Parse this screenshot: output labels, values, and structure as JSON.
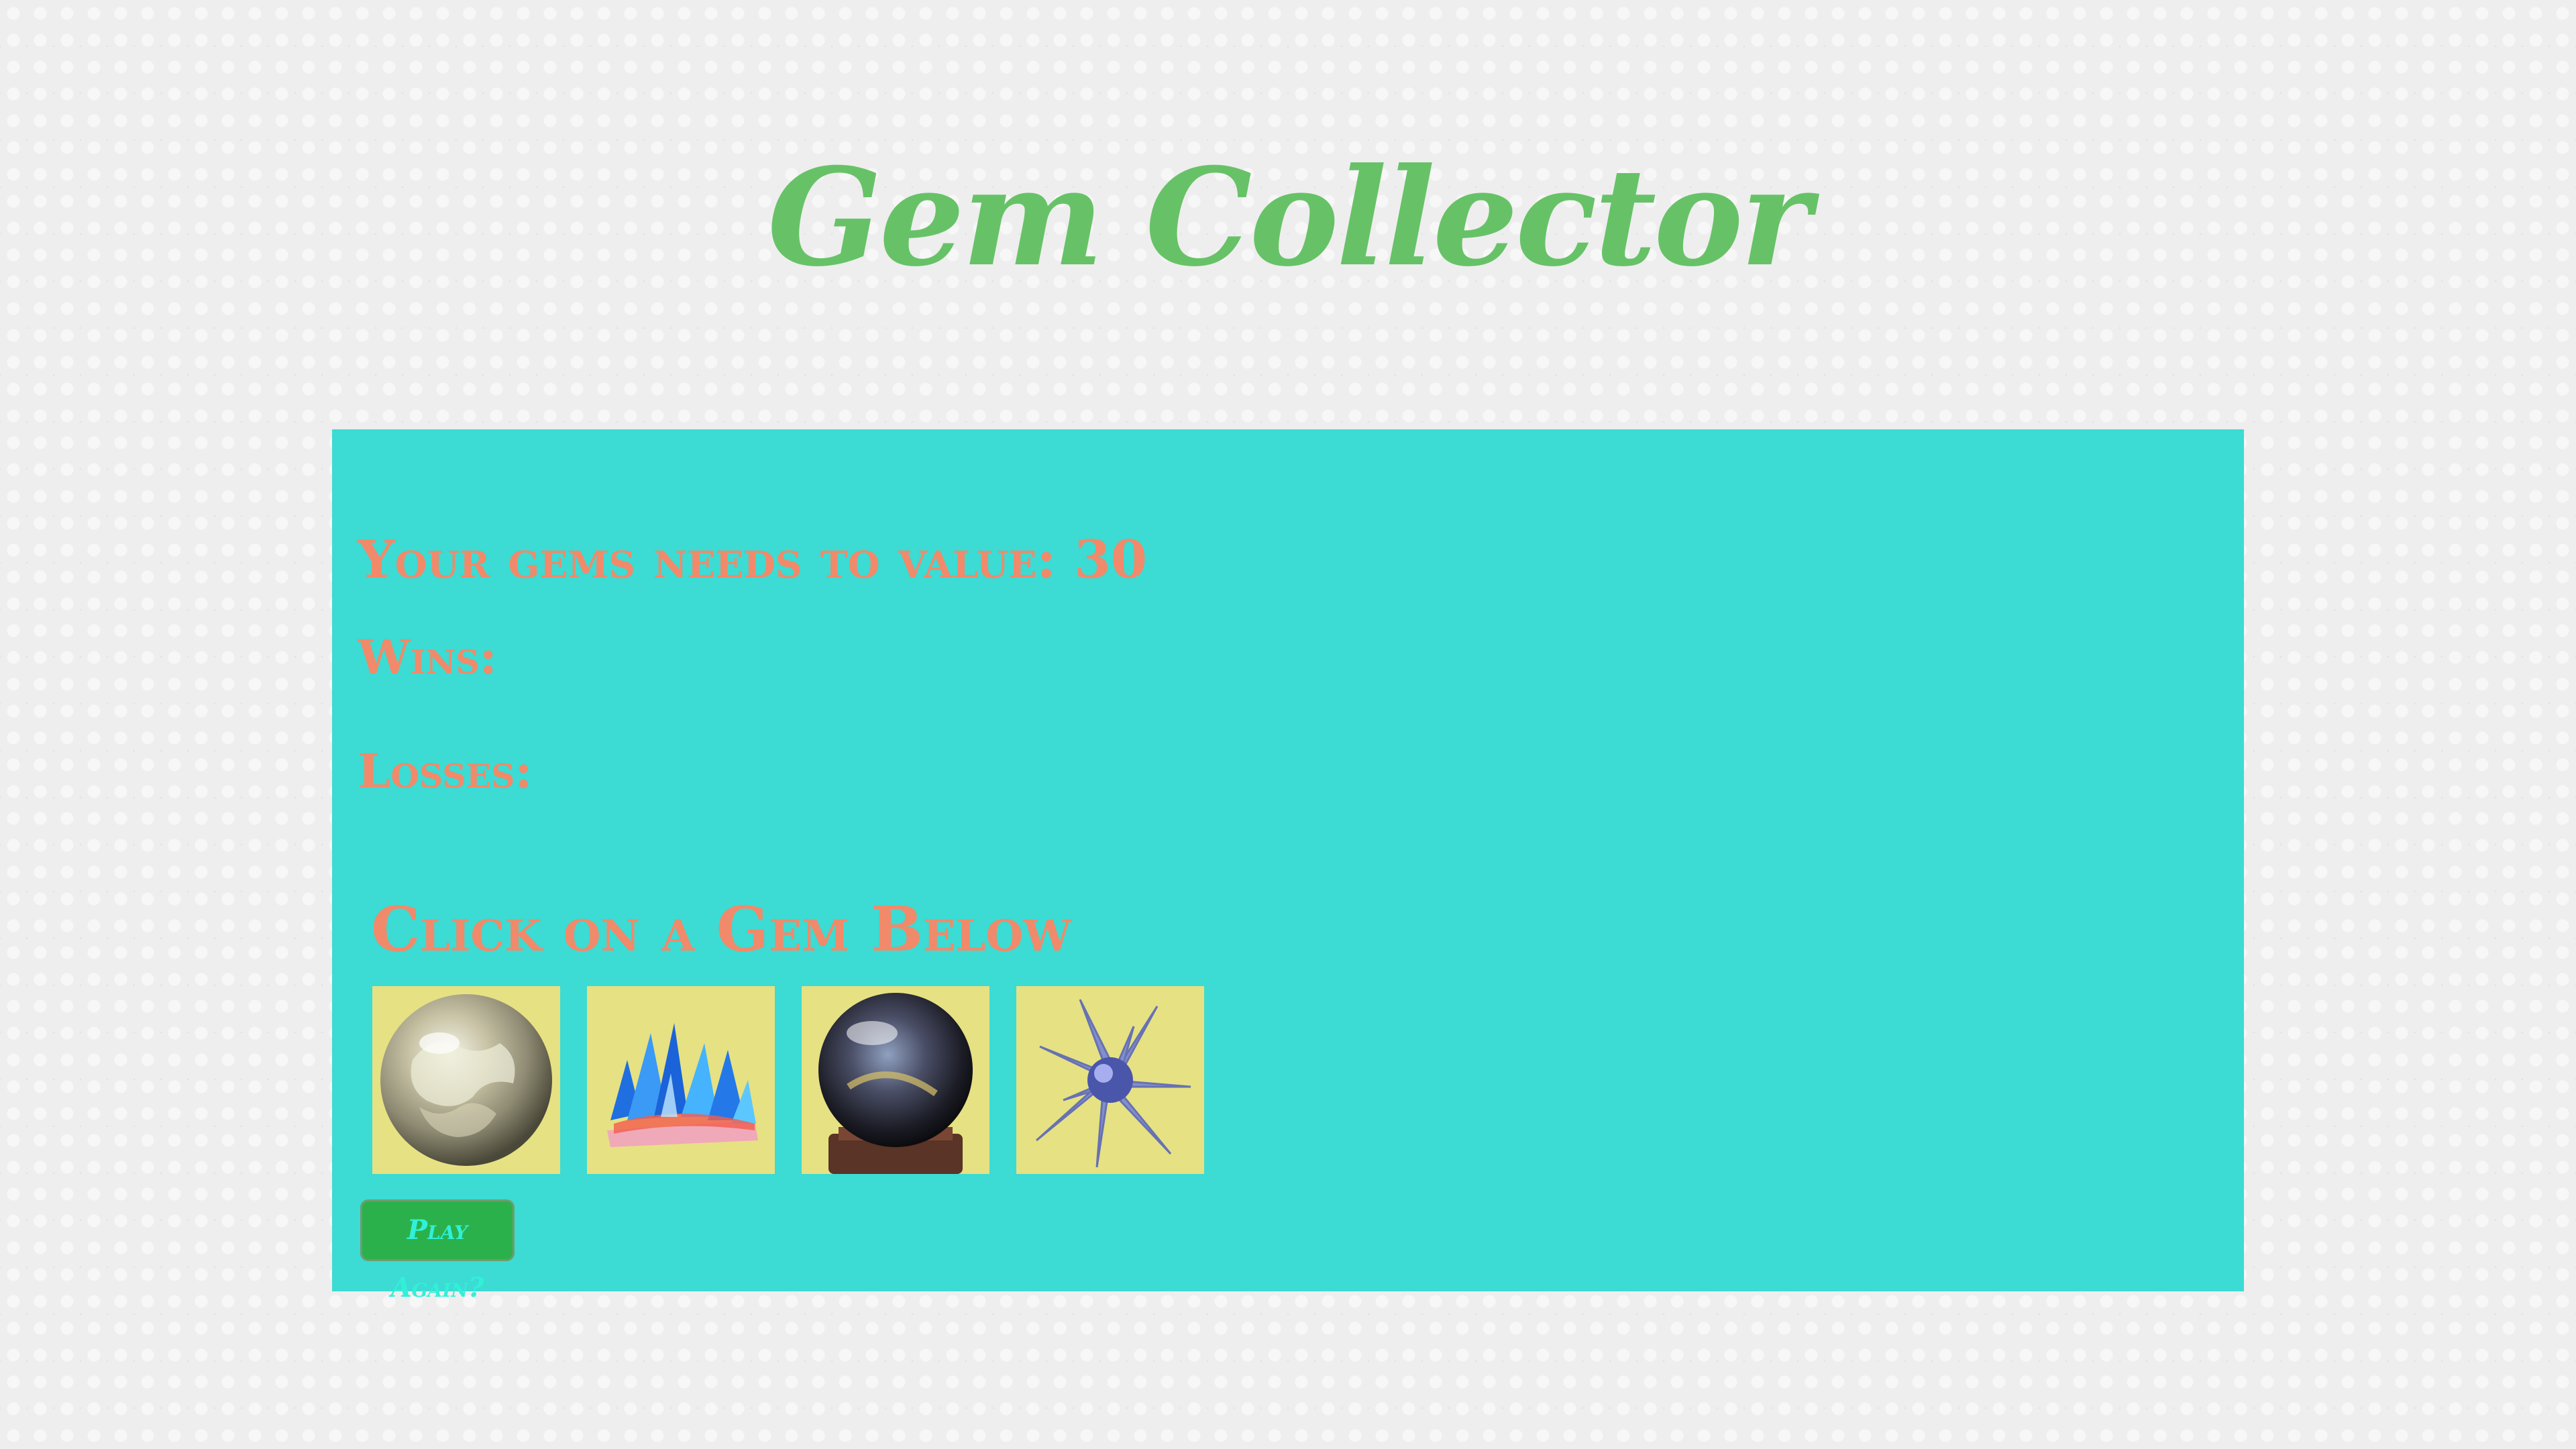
{
  "header": {
    "title": "Gem Collector"
  },
  "game": {
    "target_label": "Your gems needs to value: 30",
    "wins_label": "Wins:",
    "losses_label": "Losses:",
    "instructions": "Click on a Gem Below",
    "play_again_label": "Play Again?"
  },
  "gems": [
    {
      "icon": "silver-sphere-gem-icon"
    },
    {
      "icon": "blue-crystal-cluster-gem-icon"
    },
    {
      "icon": "crystal-ball-gem-icon"
    },
    {
      "icon": "blue-spiky-cluster-gem-icon"
    }
  ],
  "colors": {
    "background": "#eeeeee",
    "title": "#67c267",
    "panel": "#3cdbd3",
    "text": "#f08a6a",
    "gem_tile": "#e6e183",
    "button": "#2bb14c",
    "button_text": "#31f0d8"
  }
}
